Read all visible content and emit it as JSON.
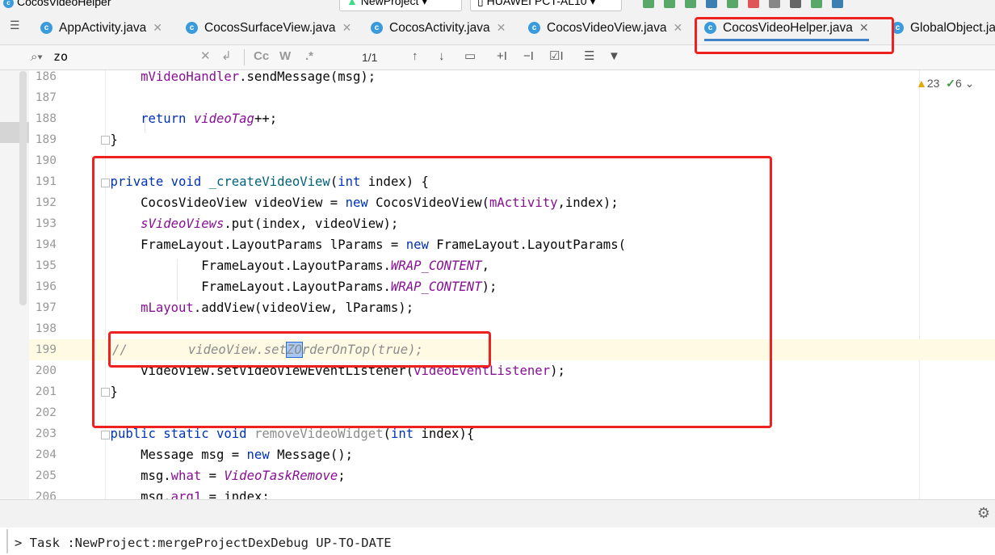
{
  "window": {
    "title": "CocosVideoHelper"
  },
  "toolbar": {
    "run_config": "NewProject",
    "device": "HUAWEI PCT-AL10"
  },
  "tabs": [
    {
      "label": "AppActivity.java",
      "active": false
    },
    {
      "label": "CocosSurfaceView.java",
      "active": false
    },
    {
      "label": "CocosActivity.java",
      "active": false
    },
    {
      "label": "CocosVideoView.java",
      "active": false
    },
    {
      "label": "CocosVideoHelper.java",
      "active": true
    },
    {
      "label": "GlobalObject.java",
      "active": false
    }
  ],
  "search": {
    "value": "zo",
    "match_case": "Cc",
    "words": "W",
    "regex": ".*",
    "match_count": "1/1"
  },
  "inspections": {
    "warnings": "23",
    "weak_warnings": "6"
  },
  "editor": {
    "lines": [
      {
        "n": "186",
        "text": "        mVideoHandler.sendMessage(msg);"
      },
      {
        "n": "187",
        "text": ""
      },
      {
        "n": "188",
        "text": "        return videoTag++;"
      },
      {
        "n": "189",
        "text": "    }"
      },
      {
        "n": "190",
        "text": ""
      },
      {
        "n": "191",
        "text": "    private void _createVideoView(int index) {"
      },
      {
        "n": "192",
        "text": "        CocosVideoView videoView = new CocosVideoView(mActivity,index);"
      },
      {
        "n": "193",
        "text": "        sVideoViews.put(index, videoView);"
      },
      {
        "n": "194",
        "text": "        FrameLayout.LayoutParams lParams = new FrameLayout.LayoutParams("
      },
      {
        "n": "195",
        "text": "                FrameLayout.LayoutParams.WRAP_CONTENT,"
      },
      {
        "n": "196",
        "text": "                FrameLayout.LayoutParams.WRAP_CONTENT);"
      },
      {
        "n": "197",
        "text": "        mLayout.addView(videoView, lParams);"
      },
      {
        "n": "198",
        "text": ""
      },
      {
        "n": "199",
        "text": "//        videoView.setZOrderOnTop(true);"
      },
      {
        "n": "200",
        "text": "        videoView.setVideoViewEventListener(videoEventListener);"
      },
      {
        "n": "201",
        "text": "    }"
      },
      {
        "n": "202",
        "text": ""
      },
      {
        "n": "203",
        "text": "    public static void removeVideoWidget(int index){"
      },
      {
        "n": "204",
        "text": "        Message msg = new Message();"
      },
      {
        "n": "205",
        "text": "        msg.what = VideoTaskRemove;"
      },
      {
        "n": "206",
        "text": "        msg.arg1 = index;"
      }
    ]
  },
  "console": {
    "line": "> Task :NewProject:mergeProjectDexDebug UP-TO-DATE"
  },
  "colors": {
    "keyword": "#0033b3",
    "field": "#871094",
    "comment": "#8c8c8c",
    "method": "#00627a",
    "annotation": "#ef2020",
    "tab_underline": "#4083c9"
  }
}
